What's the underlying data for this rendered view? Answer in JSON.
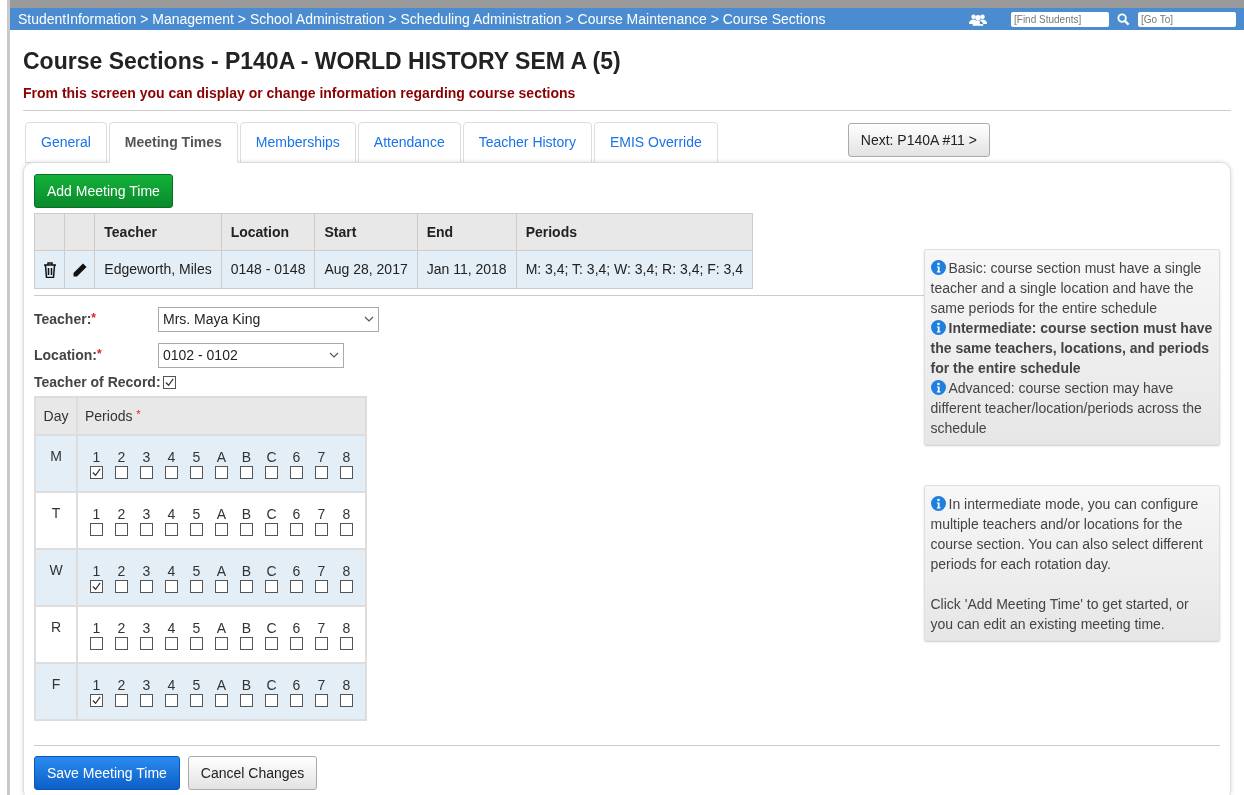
{
  "breadcrumb": "StudentInformation > Management > School Administration > Scheduling Administration > Course Maintenance > Course Sections",
  "search": {
    "placeholder": "[Find Students]"
  },
  "goto": {
    "placeholder": "[Go To]"
  },
  "title": "Course Sections - P140A - WORLD HISTORY SEM A (5)",
  "subtitle": "From this screen you can display or change information regarding course sections",
  "tabs": [
    {
      "label": "General",
      "selected": false
    },
    {
      "label": "Meeting Times",
      "selected": true
    },
    {
      "label": "Memberships",
      "selected": false
    },
    {
      "label": "Attendance",
      "selected": false
    },
    {
      "label": "Teacher History",
      "selected": false
    },
    {
      "label": "EMIS Override",
      "selected": false
    }
  ],
  "next_button": "Next: P140A #11 >",
  "add_button": "Add Meeting Time",
  "table": {
    "columns": [
      "Teacher",
      "Location",
      "Start",
      "End",
      "Periods"
    ],
    "rows": [
      {
        "cells": [
          "Edgeworth, Miles",
          "0148 - 0148",
          "Aug 28, 2017",
          "Jan 11, 2018",
          "M: 3,4; T: 3,4; W: 3,4; R: 3,4; F: 3,4"
        ]
      }
    ]
  },
  "form": {
    "teacher_label": "Teacher:",
    "teacher_value": "Mrs. Maya King",
    "location_label": "Location:",
    "location_value": "0102 - 0102",
    "record_label": "Teacher of Record:",
    "record_checked": true,
    "required_mark": "*"
  },
  "periods_table": {
    "day_header": "Day",
    "periods_header": "Periods",
    "required_mark": "*",
    "days": [
      {
        "day": "M",
        "periods": [
          {
            "label": "1",
            "checked": true
          },
          {
            "label": "2",
            "checked": false
          },
          {
            "label": "3",
            "checked": false
          },
          {
            "label": "4",
            "checked": false
          },
          {
            "label": "5",
            "checked": false
          },
          {
            "label": "A",
            "checked": false
          },
          {
            "label": "B",
            "checked": false
          },
          {
            "label": "C",
            "checked": false
          },
          {
            "label": "6",
            "checked": false
          },
          {
            "label": "7",
            "checked": false
          },
          {
            "label": "8",
            "checked": false
          }
        ]
      },
      {
        "day": "T",
        "periods": [
          {
            "label": "1",
            "checked": false
          },
          {
            "label": "2",
            "checked": false
          },
          {
            "label": "3",
            "checked": false
          },
          {
            "label": "4",
            "checked": false
          },
          {
            "label": "5",
            "checked": false
          },
          {
            "label": "A",
            "checked": false
          },
          {
            "label": "B",
            "checked": false
          },
          {
            "label": "C",
            "checked": false
          },
          {
            "label": "6",
            "checked": false
          },
          {
            "label": "7",
            "checked": false
          },
          {
            "label": "8",
            "checked": false
          }
        ]
      },
      {
        "day": "W",
        "periods": [
          {
            "label": "1",
            "checked": true
          },
          {
            "label": "2",
            "checked": false
          },
          {
            "label": "3",
            "checked": false
          },
          {
            "label": "4",
            "checked": false
          },
          {
            "label": "5",
            "checked": false
          },
          {
            "label": "A",
            "checked": false
          },
          {
            "label": "B",
            "checked": false
          },
          {
            "label": "C",
            "checked": false
          },
          {
            "label": "6",
            "checked": false
          },
          {
            "label": "7",
            "checked": false
          },
          {
            "label": "8",
            "checked": false
          }
        ]
      },
      {
        "day": "R",
        "periods": [
          {
            "label": "1",
            "checked": false
          },
          {
            "label": "2",
            "checked": false
          },
          {
            "label": "3",
            "checked": false
          },
          {
            "label": "4",
            "checked": false
          },
          {
            "label": "5",
            "checked": false
          },
          {
            "label": "A",
            "checked": false
          },
          {
            "label": "B",
            "checked": false
          },
          {
            "label": "C",
            "checked": false
          },
          {
            "label": "6",
            "checked": false
          },
          {
            "label": "7",
            "checked": false
          },
          {
            "label": "8",
            "checked": false
          }
        ]
      },
      {
        "day": "F",
        "periods": [
          {
            "label": "1",
            "checked": true
          },
          {
            "label": "2",
            "checked": false
          },
          {
            "label": "3",
            "checked": false
          },
          {
            "label": "4",
            "checked": false
          },
          {
            "label": "5",
            "checked": false
          },
          {
            "label": "A",
            "checked": false
          },
          {
            "label": "B",
            "checked": false
          },
          {
            "label": "C",
            "checked": false
          },
          {
            "label": "6",
            "checked": false
          },
          {
            "label": "7",
            "checked": false
          },
          {
            "label": "8",
            "checked": false
          }
        ]
      }
    ]
  },
  "info_boxes": [
    {
      "paragraphs": [
        {
          "text": "Basic: course section must have a single teacher and a single location and have the same periods for the entire schedule",
          "icon": true,
          "bold": false
        },
        {
          "text": "Intermediate: course section must have the same teachers, locations, and periods for the entire schedule",
          "icon": true,
          "bold": true
        },
        {
          "text": "Advanced: course section may have different teacher/location/periods across the schedule",
          "icon": true,
          "bold": false
        }
      ]
    },
    {
      "paragraphs": [
        {
          "text": "In intermediate mode, you can configure multiple teachers and/or locations for the course section. You can also select different periods for each rotation day.",
          "icon": true,
          "bold": false
        },
        {
          "text": "Click 'Add Meeting Time' to get started, or you can edit an existing meeting time.",
          "icon": false,
          "bold": false
        }
      ]
    }
  ],
  "save_button": "Save Meeting Time",
  "cancel_button": "Cancel Changes"
}
